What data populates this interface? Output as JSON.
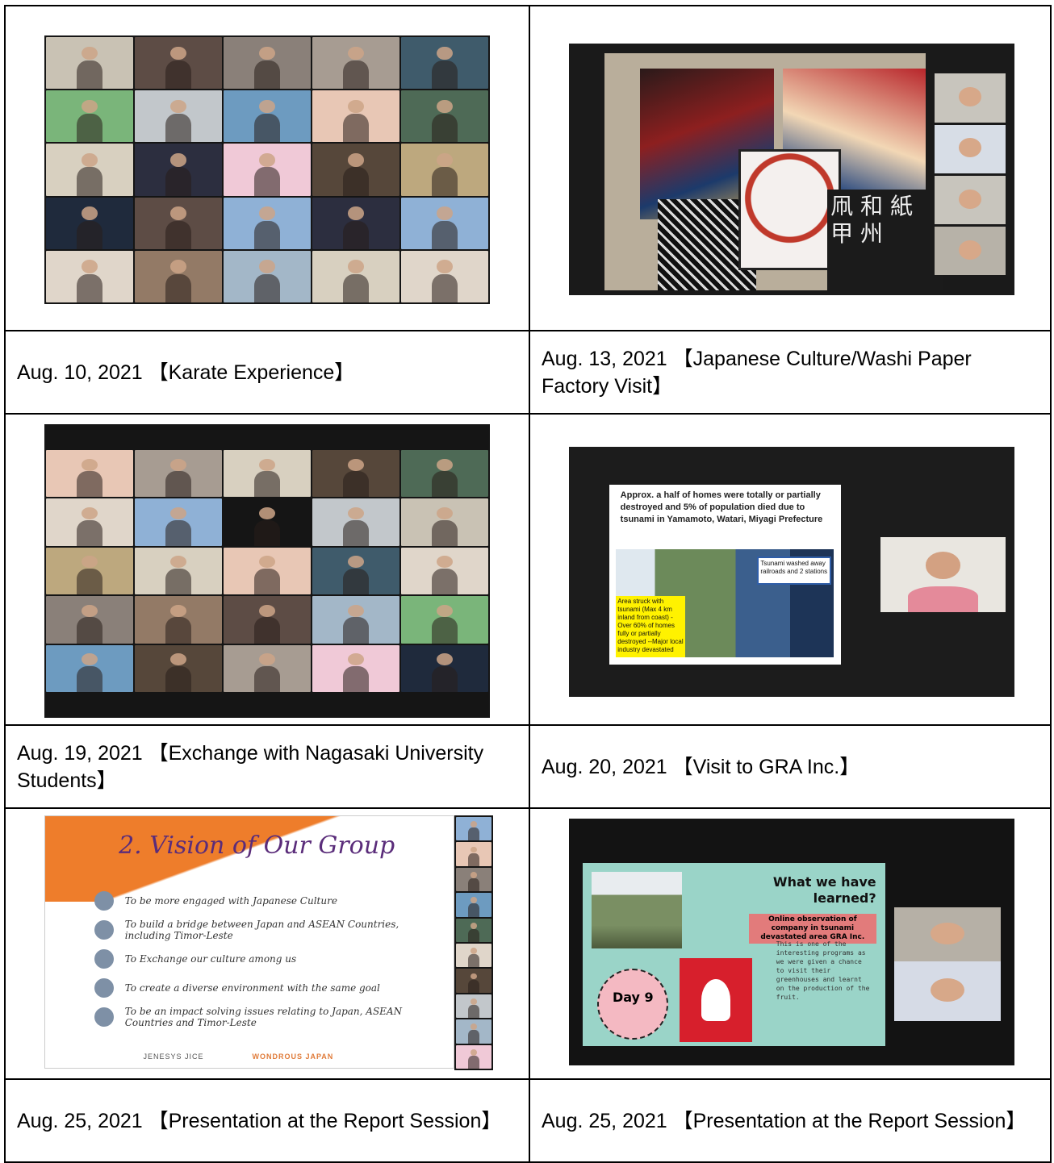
{
  "captions": {
    "r1_left": "Aug. 10, 2021 【Karate Experience】",
    "r1_right": "Aug. 13, 2021 【Japanese Culture/Washi Paper Factory Visit】",
    "r2_left": "Aug. 19, 2021 【Exchange with Nagasaki University Students】",
    "r2_right": "Aug. 20, 2021 【Visit to GRA Inc.】",
    "r3_left": "Aug. 25, 2021 【Presentation at the Report Session】",
    "r3_right": "Aug. 25, 2021 【Presentation at the Report Session】"
  },
  "photos": {
    "washi_sign": "凧 和 紙 甲 州",
    "tsunami_title": "Approx. a half of homes were totally or partially destroyed and 5% of population died due to tsunami in Yamamoto, Watari, Miyagi Prefecture",
    "tsunami_callout_blue": "Tsunami washed away railroads and 2 stations",
    "tsunami_callout_yellow": "Area struck with tsunami (Max 4 km inland from coast) -Over 60% of homes fully or partially destroyed --Major local industry devastated",
    "vision_title": "2. Vision of Our Group",
    "vision_items": [
      "To be more engaged with Japanese Culture",
      "To build a bridge between Japan and ASEAN Countries, including Timor-Leste",
      "To Exchange our culture among us",
      "To create a diverse environment with the same goal",
      "To be an impact solving issues relating to Japan, ASEAN Countries and Timor-Leste"
    ],
    "vision_footer_left": "JENESYS  JICE",
    "vision_footer_right": "WONDROUS JAPAN",
    "day_heading": "What we have learned?",
    "day_sub": "Online observation of company in tsunami devastated area GRA Inc.",
    "day_body": "This is one of the interesting programs as we were given a chance to visit their greenhouses and learnt on the production of the fruit.",
    "day_badge": "Day 9"
  }
}
